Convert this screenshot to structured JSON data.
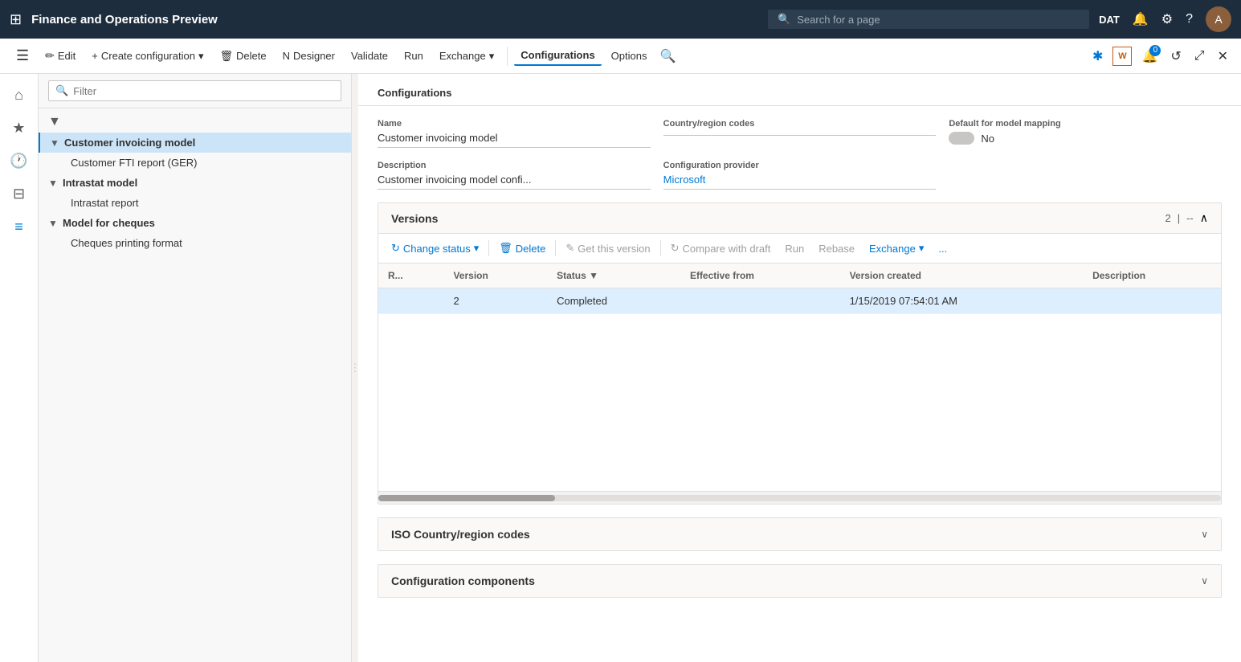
{
  "topbar": {
    "grid_icon": "⊞",
    "title": "Finance and Operations Preview",
    "search_placeholder": "Search for a page",
    "dat_label": "DAT",
    "notification_icon": "🔔",
    "settings_icon": "⚙",
    "help_icon": "?",
    "avatar_initial": "A"
  },
  "commandbar": {
    "edit_label": "Edit",
    "create_label": "Create configuration",
    "delete_label": "Delete",
    "designer_label": "Designer",
    "validate_label": "Validate",
    "run_label": "Run",
    "exchange_label": "Exchange",
    "configurations_label": "Configurations",
    "options_label": "Options",
    "search_icon": "🔍",
    "bookmark_icon": "✱",
    "office_icon": "W",
    "badge_count": "0",
    "refresh_icon": "↺",
    "expand_icon": "⤢",
    "close_icon": "✕"
  },
  "sidebar": {
    "icons": [
      {
        "name": "home-icon",
        "symbol": "⌂",
        "active": false
      },
      {
        "name": "favorites-icon",
        "symbol": "★",
        "active": false
      },
      {
        "name": "recent-icon",
        "symbol": "🕐",
        "active": false
      },
      {
        "name": "workspaces-icon",
        "symbol": "⊞",
        "active": false
      },
      {
        "name": "modules-icon",
        "symbol": "≡",
        "active": true
      }
    ]
  },
  "filter": {
    "placeholder": "Filter",
    "search_icon": "🔍"
  },
  "tree": {
    "items": [
      {
        "id": "customer-invoicing-model",
        "label": "Customer invoicing model",
        "level": 0,
        "expanded": true,
        "selected": true,
        "type": "group",
        "icon": "▼"
      },
      {
        "id": "customer-fti-report",
        "label": "Customer FTI report (GER)",
        "level": 1,
        "expanded": false,
        "selected": false,
        "type": "child"
      },
      {
        "id": "intrastat-model",
        "label": "Intrastat model",
        "level": 0,
        "expanded": true,
        "selected": false,
        "type": "group",
        "icon": "▼"
      },
      {
        "id": "intrastat-report",
        "label": "Intrastat report",
        "level": 1,
        "expanded": false,
        "selected": false,
        "type": "child"
      },
      {
        "id": "model-for-cheques",
        "label": "Model for cheques",
        "level": 0,
        "expanded": true,
        "selected": false,
        "type": "group",
        "icon": "▼"
      },
      {
        "id": "cheques-printing-format",
        "label": "Cheques printing format",
        "level": 1,
        "expanded": false,
        "selected": false,
        "type": "child"
      }
    ]
  },
  "main": {
    "section_title": "Configurations",
    "form": {
      "name_label": "Name",
      "name_value": "Customer invoicing model",
      "country_region_label": "Country/region codes",
      "country_region_value": "",
      "default_model_label": "Default for model mapping",
      "default_model_value": "No",
      "description_label": "Description",
      "description_value": "Customer invoicing model confi...",
      "config_provider_label": "Configuration provider",
      "config_provider_value": "Microsoft"
    },
    "versions": {
      "title": "Versions",
      "count": "2",
      "separator": "--",
      "toolbar": {
        "change_status_label": "Change status",
        "delete_label": "Delete",
        "get_this_version_label": "Get this version",
        "compare_with_draft_label": "Compare with draft",
        "run_label": "Run",
        "rebase_label": "Rebase",
        "exchange_label": "Exchange",
        "more_label": "..."
      },
      "columns": [
        {
          "id": "r",
          "label": "R..."
        },
        {
          "id": "version",
          "label": "Version"
        },
        {
          "id": "status",
          "label": "Status"
        },
        {
          "id": "effective_from",
          "label": "Effective from"
        },
        {
          "id": "version_created",
          "label": "Version created"
        },
        {
          "id": "description",
          "label": "Description"
        }
      ],
      "rows": [
        {
          "r": "",
          "version": "2",
          "status": "Completed",
          "effective_from": "",
          "version_created": "1/15/2019 07:54:01 AM",
          "description": "",
          "selected": true
        }
      ]
    },
    "iso_section": {
      "title": "ISO Country/region codes"
    },
    "config_components_section": {
      "title": "Configuration components"
    }
  }
}
